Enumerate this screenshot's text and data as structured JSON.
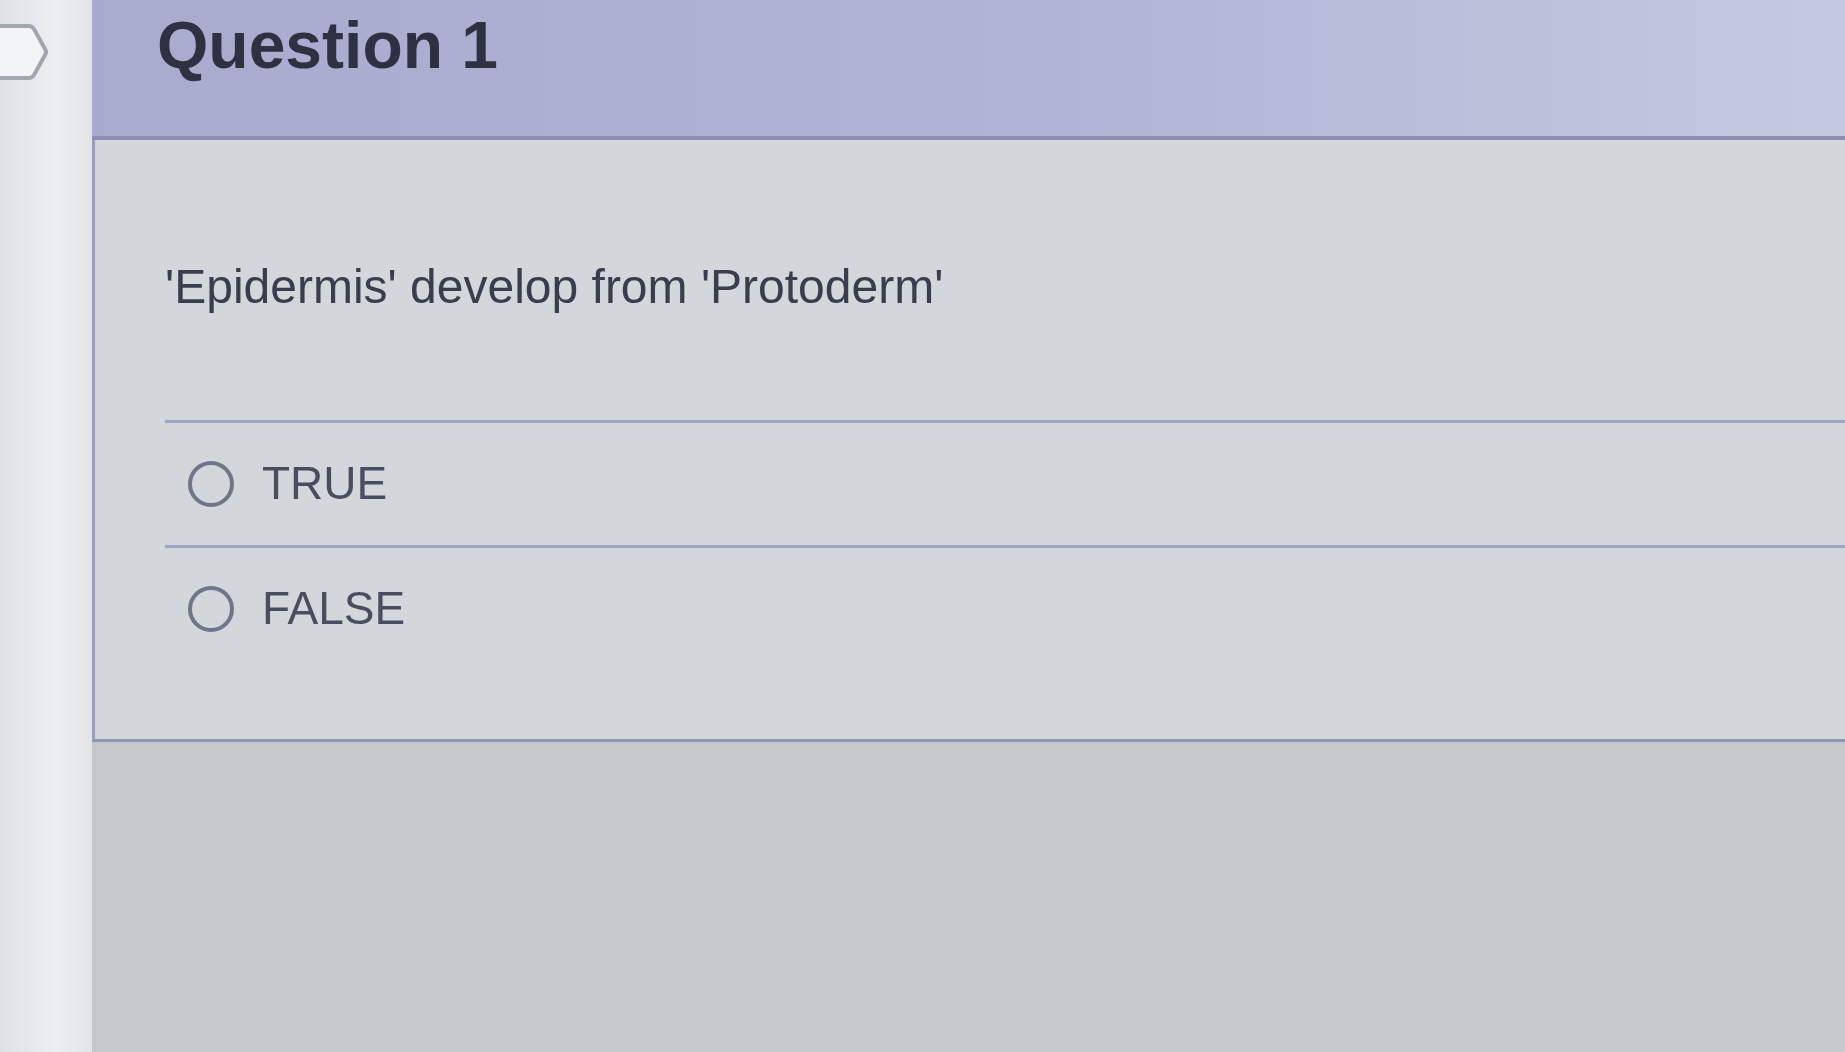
{
  "question": {
    "title": "Question 1",
    "text": "'Epidermis' develop from 'Protoderm'",
    "answers": [
      {
        "label": "TRUE",
        "selected": false
      },
      {
        "label": "FALSE",
        "selected": false
      }
    ]
  }
}
